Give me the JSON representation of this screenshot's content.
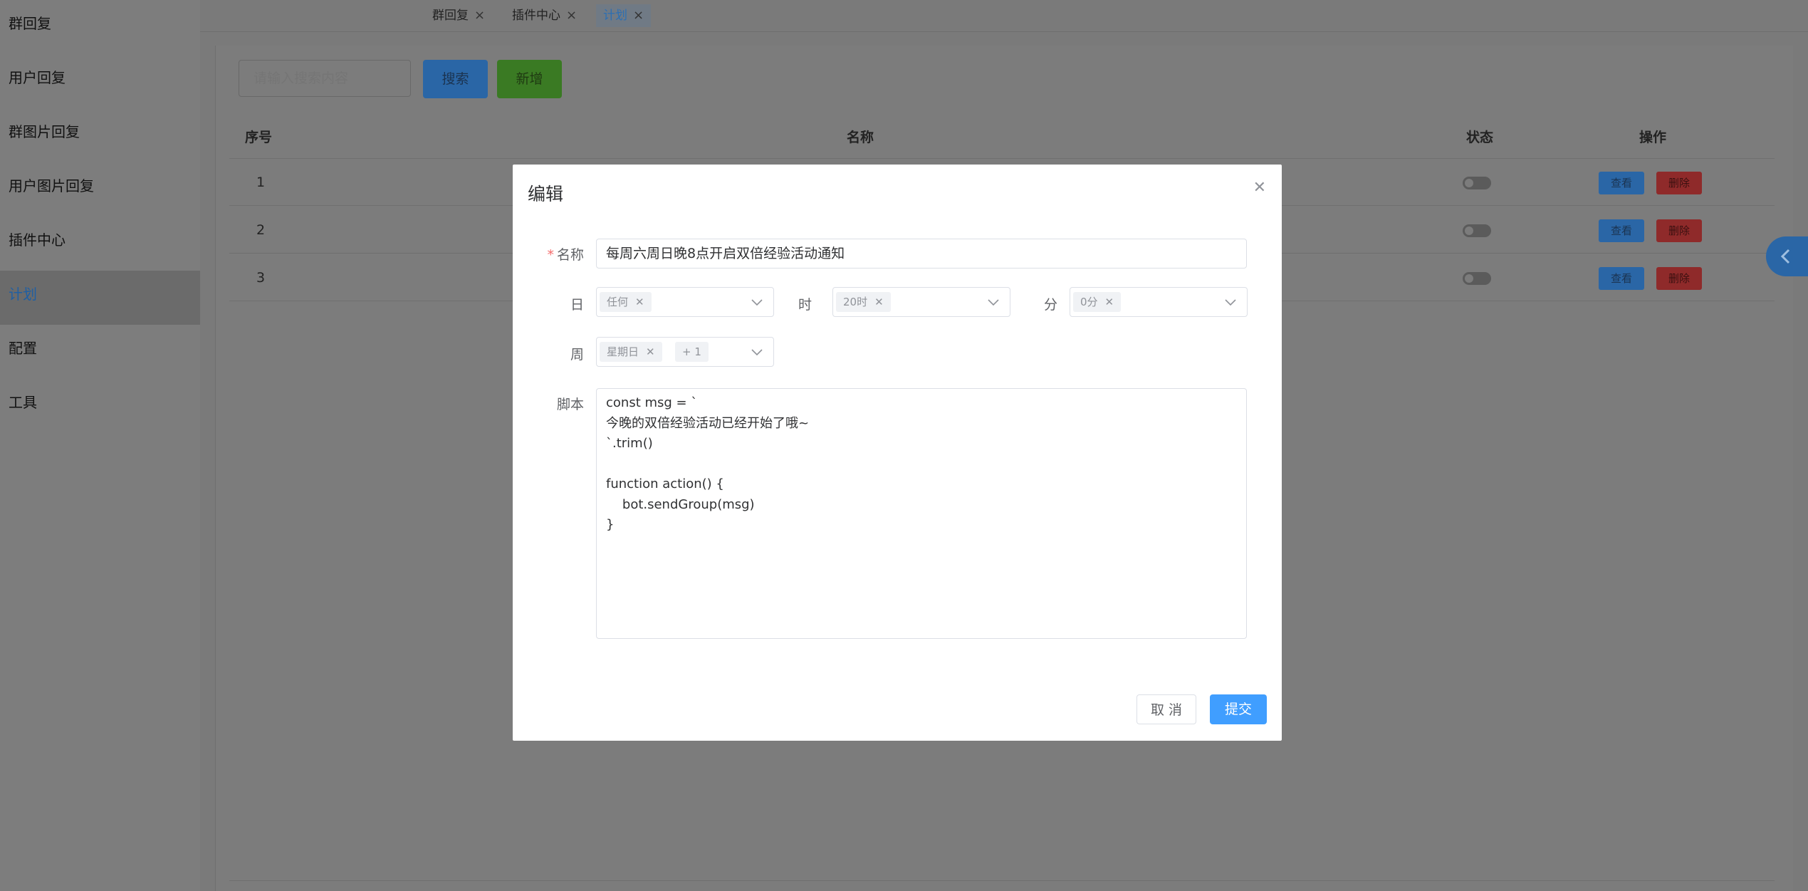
{
  "sidebar": {
    "items": [
      {
        "label": "群回复"
      },
      {
        "label": "用户回复"
      },
      {
        "label": "群图片回复"
      },
      {
        "label": "用户图片回复"
      },
      {
        "label": "插件中心"
      },
      {
        "label": "计划"
      },
      {
        "label": "配置"
      },
      {
        "label": "工具"
      }
    ],
    "active_index": 5
  },
  "tabs": [
    {
      "label": "群回复"
    },
    {
      "label": "插件中心"
    },
    {
      "label": "计划"
    }
  ],
  "toolbar": {
    "search_placeholder": "请输入搜索内容",
    "search_label": "搜索",
    "add_label": "新增"
  },
  "table": {
    "headers": {
      "index": "序号",
      "name": "名称",
      "status": "状态",
      "actions": "操作"
    },
    "rows": [
      {
        "index": "1",
        "view": "查看",
        "delete": "删除",
        "enabled": false
      },
      {
        "index": "2",
        "view": "查看",
        "delete": "删除",
        "enabled": false
      },
      {
        "index": "3",
        "view": "查看",
        "delete": "删除",
        "enabled": false
      }
    ]
  },
  "modal": {
    "title": "编辑",
    "fields": {
      "name_label": "名称",
      "name_value": "每周六周日晚8点开启双倍经验活动通知",
      "day_label": "日",
      "day_chip": "任何",
      "hour_label": "时",
      "hour_chip": "20时",
      "minute_label": "分",
      "minute_chip": "0分",
      "week_label": "周",
      "week_chip": "星期日",
      "week_more": "+ 1",
      "script_label": "脚本",
      "script_value": "const msg = `\n今晚的双倍经验活动已经开始了哦~\n`.trim()\n\nfunction action() {\n    bot.sendGroup(msg)\n}"
    },
    "cancel_label": "取 消",
    "submit_label": "提交"
  },
  "colors": {
    "primary": "#409eff",
    "required": "#f56c6c",
    "overlay": "#7a7a7a"
  }
}
